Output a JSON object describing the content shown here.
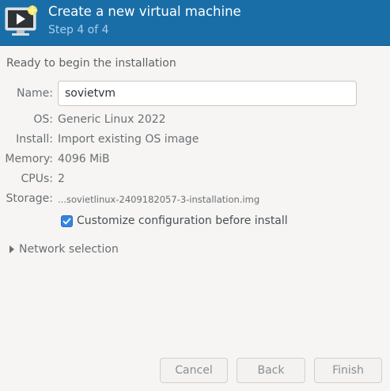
{
  "header": {
    "title": "Create a new virtual machine",
    "subtitle": "Step 4 of 4",
    "icon": "monitor-play-icon"
  },
  "status": {
    "ready_text": "Ready to begin the installation"
  },
  "details": {
    "name_label": "Name:",
    "name_value": "sovietvm",
    "os_label": "OS:",
    "os_value": "Generic Linux 2022",
    "install_label": "Install:",
    "install_value": "Import existing OS image",
    "memory_label": "Memory:",
    "memory_value": "4096 MiB",
    "cpus_label": "CPUs:",
    "cpus_value": "2",
    "storage_label": "Storage:",
    "storage_value": "...sovietlinux-2409182057-3-installation.img"
  },
  "options": {
    "customize_label": "Customize configuration before install",
    "customize_checked": true
  },
  "network": {
    "expander_label": "Network selection",
    "expanded": false
  },
  "buttons": {
    "cancel": "Cancel",
    "back": "Back",
    "finish": "Finish"
  },
  "colors": {
    "header_bg": "#1a6ea8",
    "accent": "#3584e4",
    "window_bg": "#f6f5f4"
  }
}
